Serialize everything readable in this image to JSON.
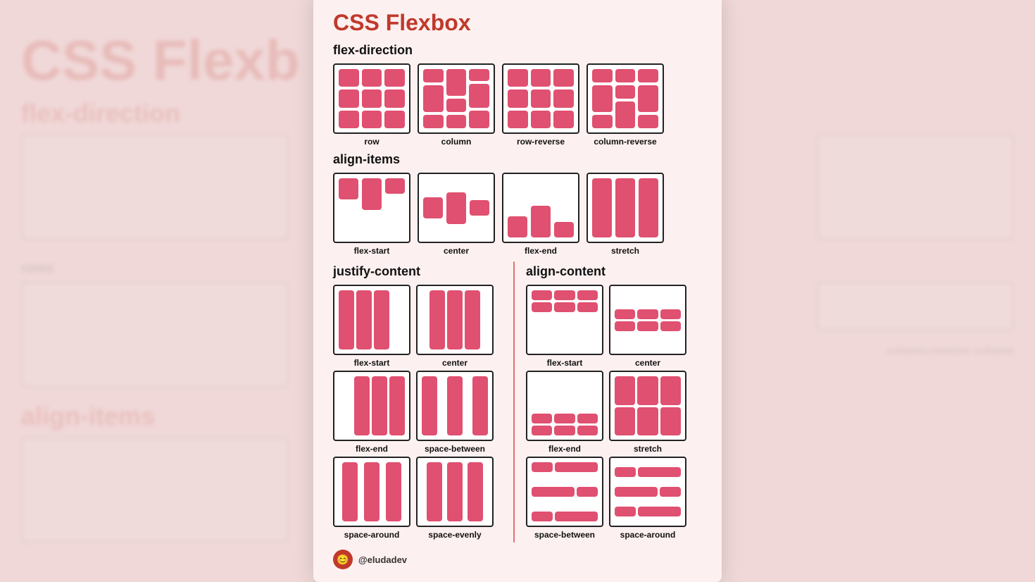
{
  "title": "CSS Flexbox",
  "sections": {
    "flex_direction": {
      "title": "flex-direction",
      "items": [
        {
          "label": "row"
        },
        {
          "label": "column"
        },
        {
          "label": "row-reverse"
        },
        {
          "label": "column-reverse"
        }
      ]
    },
    "align_items": {
      "title": "align-items",
      "items": [
        {
          "label": "flex-start"
        },
        {
          "label": "center"
        },
        {
          "label": "flex-end"
        },
        {
          "label": "stretch"
        }
      ]
    },
    "justify_content": {
      "title": "justify-content",
      "items": [
        {
          "label": "flex-start"
        },
        {
          "label": "center"
        },
        {
          "label": "flex-end"
        },
        {
          "label": "space-between"
        },
        {
          "label": "space-around"
        },
        {
          "label": "space-evenly"
        }
      ]
    },
    "align_content": {
      "title": "align-content",
      "items": [
        {
          "label": "flex-start"
        },
        {
          "label": "center"
        },
        {
          "label": "flex-end"
        },
        {
          "label": "stretch"
        },
        {
          "label": "space-between"
        },
        {
          "label": "space-around"
        }
      ]
    }
  },
  "footer": {
    "handle": "@eludadev"
  }
}
